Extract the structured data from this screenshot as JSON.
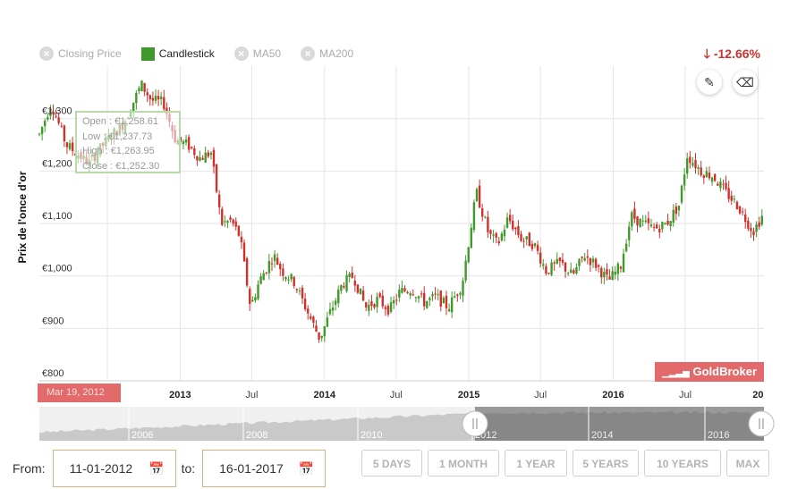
{
  "legend": [
    {
      "label": "Closing Price",
      "active": false
    },
    {
      "label": "Candlestick",
      "active": true
    },
    {
      "label": "MA50",
      "active": false
    },
    {
      "label": "MA200",
      "active": false
    }
  ],
  "change": "-12.66%",
  "icons": {
    "down": "arrow-down-icon",
    "pen": "pencil-icon",
    "eraser": "eraser-icon",
    "calendar": "calendar-icon"
  },
  "colors": {
    "up": "#3f9a2b",
    "down": "#d0312d",
    "accent": "#e36a6a"
  },
  "tooltip": {
    "open": "Open : €1,258.61",
    "low": "Low : €1,237.73",
    "high": "High : €1,263.95",
    "close": "Close : €1,252.30"
  },
  "watermark": "GoldBroker",
  "date_flag": "Mar 19, 2012",
  "navigator_labels": [
    "2006",
    "2008",
    "2010",
    "2012",
    "2014",
    "2016"
  ],
  "controls": {
    "from_label": "From:",
    "from_value": "11-01-2012",
    "to_label": "to:",
    "to_value": "16-01-2017",
    "buttons": [
      "5 DAYS",
      "1 MONTH",
      "1 YEAR",
      "5 YEARS",
      "10 YEARS",
      "MAX"
    ]
  },
  "chart_data": {
    "type": "candlestick",
    "ylabel": "Prix de l'once d'or",
    "ylim": [
      800,
      1400
    ],
    "yticks": [
      800,
      900,
      1000,
      1100,
      1200,
      1300
    ],
    "ytick_labels": [
      "€800",
      "€900",
      "€1,000",
      "€1,100",
      "€1,200",
      "€1,300"
    ],
    "xticks": [
      {
        "label": "Jul",
        "date": "2012-07-01",
        "bold": false
      },
      {
        "label": "2013",
        "date": "2013-01-01",
        "bold": true
      },
      {
        "label": "Jul",
        "date": "2013-07-01",
        "bold": false
      },
      {
        "label": "2014",
        "date": "2014-01-01",
        "bold": true
      },
      {
        "label": "Jul",
        "date": "2014-07-01",
        "bold": false
      },
      {
        "label": "2015",
        "date": "2015-01-01",
        "bold": true
      },
      {
        "label": "Jul",
        "date": "2015-07-01",
        "bold": false
      },
      {
        "label": "2016",
        "date": "2016-01-01",
        "bold": true
      },
      {
        "label": "Jul",
        "date": "2016-07-01",
        "bold": false
      },
      {
        "label": "20",
        "date": "2017-01-01",
        "bold": true
      }
    ],
    "xrange": [
      "2012-01-11",
      "2017-01-16"
    ],
    "grid": true,
    "price_path": [
      [
        "2012-01-11",
        1270
      ],
      [
        "2012-02-10",
        1330
      ],
      [
        "2012-03-19",
        1250
      ],
      [
        "2012-05-15",
        1215
      ],
      [
        "2012-07-01",
        1260
      ],
      [
        "2012-08-10",
        1290
      ],
      [
        "2012-09-25",
        1365
      ],
      [
        "2012-10-20",
        1335
      ],
      [
        "2012-11-20",
        1330
      ],
      [
        "2012-12-20",
        1260
      ],
      [
        "2013-01-20",
        1250
      ],
      [
        "2013-02-20",
        1225
      ],
      [
        "2013-03-20",
        1235
      ],
      [
        "2013-04-15",
        1100
      ],
      [
        "2013-05-10",
        1105
      ],
      [
        "2013-06-01",
        1075
      ],
      [
        "2013-06-28",
        940
      ],
      [
        "2013-07-20",
        990
      ],
      [
        "2013-08-25",
        1040
      ],
      [
        "2013-09-15",
        1010
      ],
      [
        "2013-10-15",
        990
      ],
      [
        "2013-11-20",
        930
      ],
      [
        "2013-12-20",
        880
      ],
      [
        "2014-01-15",
        930
      ],
      [
        "2014-02-15",
        985
      ],
      [
        "2014-03-15",
        1000
      ],
      [
        "2014-04-15",
        940
      ],
      [
        "2014-05-15",
        955
      ],
      [
        "2014-06-15",
        935
      ],
      [
        "2014-07-10",
        970
      ],
      [
        "2014-08-10",
        975
      ],
      [
        "2014-09-10",
        950
      ],
      [
        "2014-10-10",
        960
      ],
      [
        "2014-11-10",
        940
      ],
      [
        "2014-12-15",
        985
      ],
      [
        "2015-01-20",
        1160
      ],
      [
        "2015-02-20",
        1080
      ],
      [
        "2015-03-15",
        1060
      ],
      [
        "2015-04-10",
        1110
      ],
      [
        "2015-05-15",
        1070
      ],
      [
        "2015-06-15",
        1060
      ],
      [
        "2015-07-15",
        1010
      ],
      [
        "2015-08-20",
        1025
      ],
      [
        "2015-09-20",
        1000
      ],
      [
        "2015-10-20",
        1040
      ],
      [
        "2015-11-20",
        1020
      ],
      [
        "2015-12-20",
        990
      ],
      [
        "2016-01-20",
        1020
      ],
      [
        "2016-02-15",
        1115
      ],
      [
        "2016-03-15",
        1100
      ],
      [
        "2016-04-15",
        1090
      ],
      [
        "2016-05-15",
        1100
      ],
      [
        "2016-06-15",
        1135
      ],
      [
        "2016-07-06",
        1230
      ],
      [
        "2016-08-10",
        1200
      ],
      [
        "2016-09-10",
        1190
      ],
      [
        "2016-10-10",
        1160
      ],
      [
        "2016-11-10",
        1135
      ],
      [
        "2016-12-20",
        1085
      ],
      [
        "2017-01-16",
        1120
      ]
    ]
  }
}
